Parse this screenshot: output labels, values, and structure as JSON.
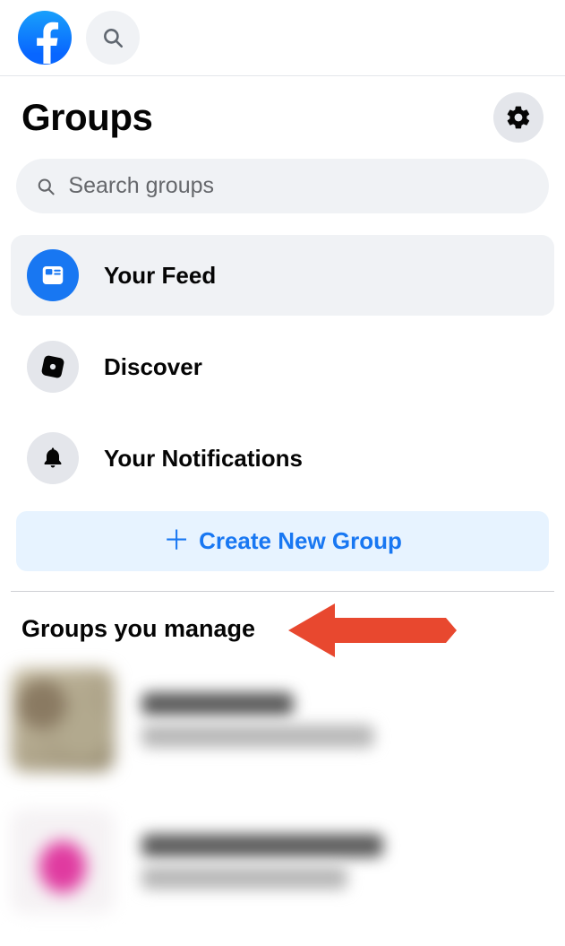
{
  "header": {
    "title": "Groups"
  },
  "search": {
    "placeholder": "Search groups"
  },
  "nav": [
    {
      "label": "Your Feed",
      "active": true
    },
    {
      "label": "Discover",
      "active": false
    },
    {
      "label": "Your Notifications",
      "active": false
    }
  ],
  "create_button": {
    "label": "Create New Group"
  },
  "section": {
    "manage_title": "Groups you manage"
  },
  "colors": {
    "brand": "#1877f2",
    "create_bg": "#e7f3ff",
    "arrow": "#e8482f"
  }
}
